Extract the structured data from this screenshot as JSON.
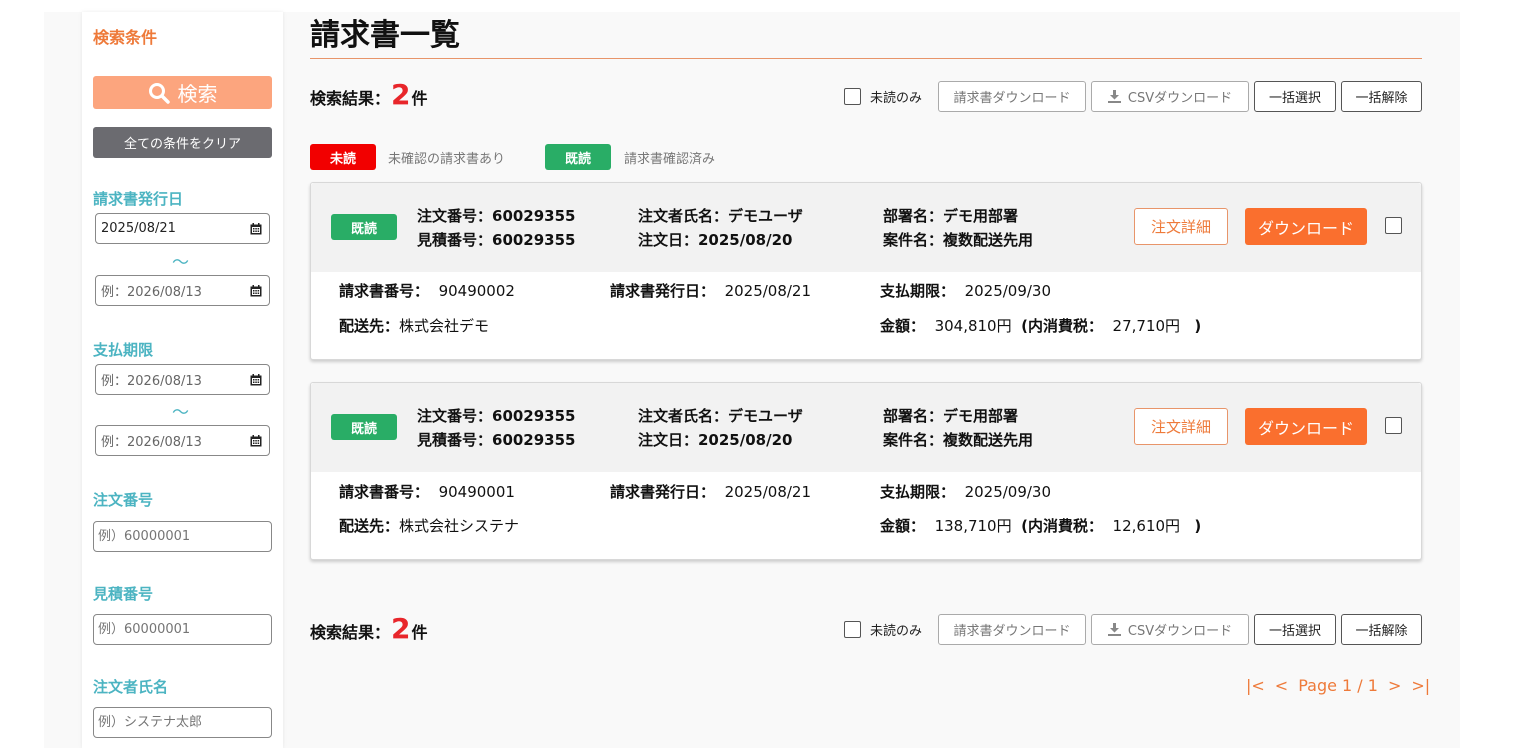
{
  "sidebar": {
    "title": "検索条件",
    "search_label": "検索",
    "clear_label": "全ての条件をクリア",
    "issue_date": {
      "label": "請求書発行日",
      "from_value": "2025/08/21",
      "to_placeholder": "例：2026/08/13",
      "tilde": "～"
    },
    "due_date": {
      "label": "支払期限",
      "from_placeholder": "例：2026/08/13",
      "to_placeholder": "例：2026/08/13",
      "tilde": "～"
    },
    "order_number": {
      "label": "注文番号",
      "placeholder": "例）60000001"
    },
    "quote_number": {
      "label": "見積番号",
      "placeholder": "例）60000001"
    },
    "orderer_name": {
      "label": "注文者氏名",
      "placeholder": "例）システナ太郎"
    }
  },
  "main": {
    "title": "請求書一覧",
    "result_prefix": "検索結果：",
    "result_count": "2",
    "result_suffix": "件",
    "toolbar": {
      "unread_only": "未読のみ",
      "invoice_download": "請求書ダウンロード",
      "csv_download": "CSVダウンロード",
      "select_all": "一括選択",
      "deselect_all": "一括解除"
    },
    "legend": {
      "unread_badge": "未読",
      "unread_desc": "未確認の請求書あり",
      "read_badge": "既読",
      "read_desc": "請求書確認済み"
    },
    "detail_label": "注文詳細",
    "download_label": "ダウンロード",
    "cards": [
      {
        "status": "既読",
        "order_no": "注文番号：60029355",
        "quote_no": "見積番号：60029355",
        "orderer": "注文者氏名：デモユーザ",
        "order_date": "注文日：2025/08/20",
        "dept": "部署名：デモ用部署",
        "project": "案件名：複数配送先用",
        "invoice_no_label": "請求書番号：",
        "invoice_no": "90490002",
        "issue_date_label": "請求書発行日：",
        "issue_date": "2025/08/21",
        "due_label": "支払期限：",
        "due": "2025/09/30",
        "ship_label": "配送先：",
        "ship_to": "株式会社デモ",
        "amount_label": "金額：",
        "amount": "304,810円",
        "tax_label": "(内消費税：",
        "tax": "27,710円",
        "tax_close": ")"
      },
      {
        "status": "既読",
        "order_no": "注文番号：60029355",
        "quote_no": "見積番号：60029355",
        "orderer": "注文者氏名：デモユーザ",
        "order_date": "注文日：2025/08/20",
        "dept": "部署名：デモ用部署",
        "project": "案件名：複数配送先用",
        "invoice_no_label": "請求書番号：",
        "invoice_no": "90490001",
        "issue_date_label": "請求書発行日：",
        "issue_date": "2025/08/21",
        "due_label": "支払期限：",
        "due": "2025/09/30",
        "ship_label": "配送先：",
        "ship_to": "株式会社システナ",
        "amount_label": "金額：",
        "amount": "138,710円",
        "tax_label": "(内消費税：",
        "tax": "12,610円",
        "tax_close": ")"
      }
    ],
    "pager": {
      "first": "|<",
      "prev": "<",
      "page_label": "Page 1 / 1",
      "next": ">",
      "last": ">|"
    }
  },
  "colors": {
    "accent": "#ee7a3a",
    "label_teal": "#4cb4c2",
    "unread_red": "#f20000",
    "read_green": "#29ad66",
    "download_orange": "#fa6f2e"
  }
}
